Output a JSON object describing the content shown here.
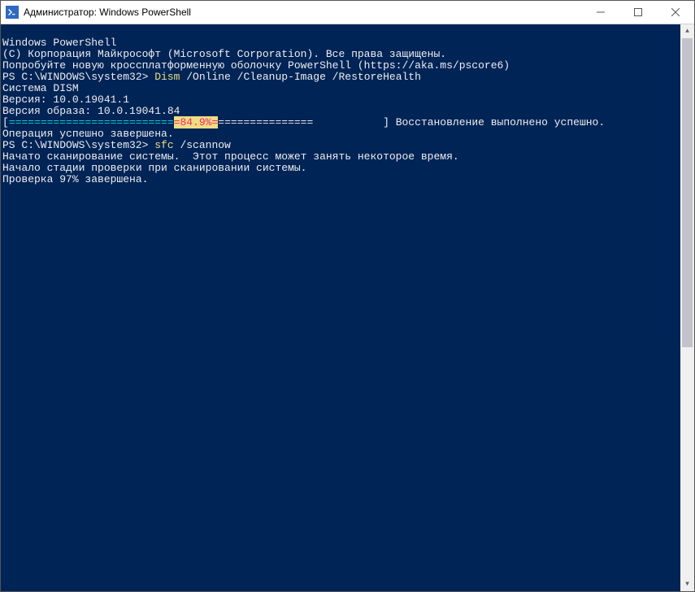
{
  "titlebar": {
    "title": "Администратор: Windows PowerShell"
  },
  "terminal": {
    "lines": {
      "l1": "Windows PowerShell",
      "l2": "(C) Корпорация Майкрософт (Microsoft Corporation). Все права защищены.",
      "l3": "",
      "l4": "Попробуйте новую кроссплатформенную оболочку PowerShell (https://aka.ms/pscore6)",
      "l5": "",
      "prompt1": "PS C:\\WINDOWS\\system32> ",
      "cmd1": "Dism",
      "cmd1args": " /Online /Cleanup-Image /RestoreHealth",
      "l7": "",
      "l8": "Cистема DISM",
      "l9": "Версия: 10.0.19041.1",
      "l10": "",
      "l11": "Версия образа: 10.0.19041.84",
      "l12": "",
      "progress_open": "[",
      "progress_fill": "==========================",
      "progress_pct": "=84.9%=",
      "progress_rest": "===============           ] ",
      "progress_status": "Восстановление выполнено успешно.",
      "l14": "Операция успешно завершена.",
      "prompt2": "PS C:\\WINDOWS\\system32> ",
      "cmd2": "sfc",
      "cmd2args": " /scannow",
      "l16": "",
      "l17": "Начато сканирование системы.  Этот процесс может занять некоторое время.",
      "l18": "",
      "l19": "Начало стадии проверки при сканировании системы.",
      "l20": "Проверка 97% завершена."
    }
  },
  "colors": {
    "terminal_bg": "#012456",
    "terminal_fg": "#eeedf0",
    "cmd_highlight": "#eedd82",
    "progress_marker": "#f92672"
  }
}
